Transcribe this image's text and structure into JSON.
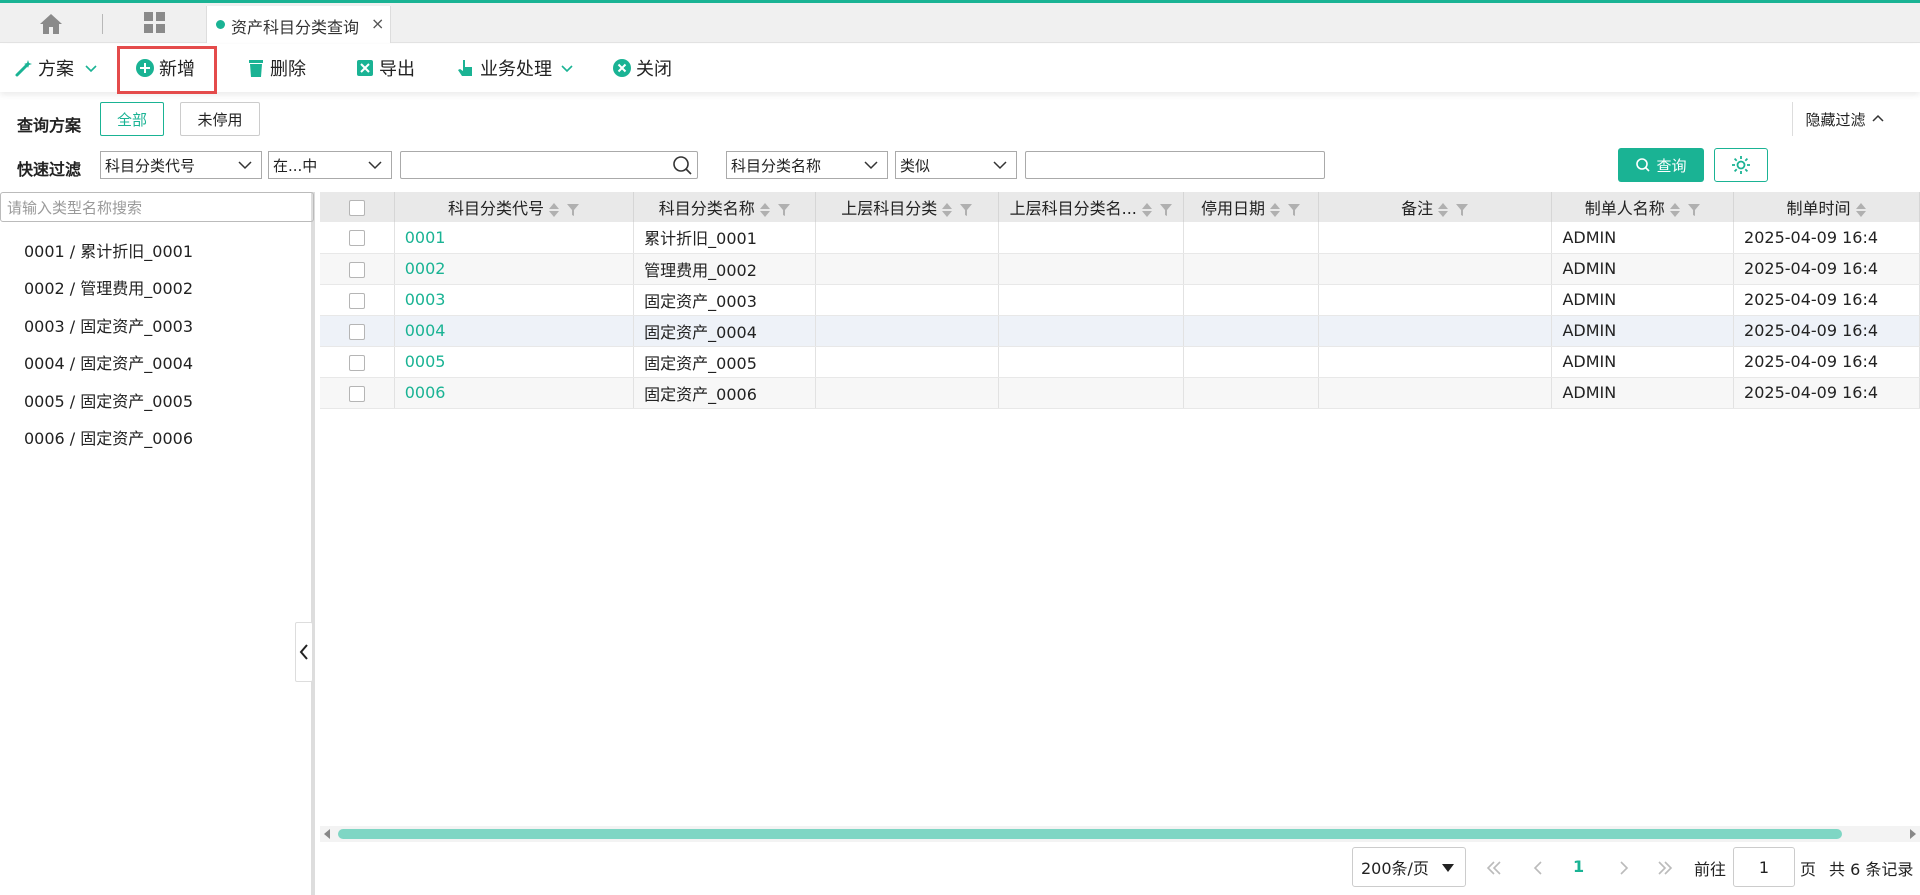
{
  "tabbar": {
    "active_tab": "资产科目分类查询",
    "close": "×"
  },
  "toolbar": {
    "plan": "方案",
    "add": "新增",
    "delete": "删除",
    "export": "导出",
    "business": "业务处理",
    "close": "关闭"
  },
  "query": {
    "plan_label": "查询方案",
    "all": "全部",
    "not_disabled": "未停用",
    "hide_filter": "隐藏过滤",
    "quick_filter_label": "快速过滤",
    "field1": "科目分类代号",
    "op1": "在...中",
    "field2": "科目分类名称",
    "op2": "类似",
    "search_button": "查询"
  },
  "left_panel": {
    "search_placeholder": "请输入类型名称搜索",
    "items": [
      "0001 / 累计折旧_0001",
      "0002 / 管理费用_0002",
      "0003 / 固定资产_0003",
      "0004 / 固定资产_0004",
      "0005 / 固定资产_0005",
      "0006 / 固定资产_0006"
    ]
  },
  "table": {
    "columns": [
      "科目分类代号",
      "科目分类名称",
      "上层科目分类",
      "上层科目分类名...",
      "停用日期",
      "备注",
      "制单人名称",
      "制单时间"
    ],
    "rows": [
      [
        "0001",
        "累计折旧_0001",
        "",
        "",
        "",
        "",
        "ADMIN",
        "2025-04-09 16:4"
      ],
      [
        "0002",
        "管理费用_0002",
        "",
        "",
        "",
        "",
        "ADMIN",
        "2025-04-09 16:4"
      ],
      [
        "0003",
        "固定资产_0003",
        "",
        "",
        "",
        "",
        "ADMIN",
        "2025-04-09 16:4"
      ],
      [
        "0004",
        "固定资产_0004",
        "",
        "",
        "",
        "",
        "ADMIN",
        "2025-04-09 16:4"
      ],
      [
        "0005",
        "固定资产_0005",
        "",
        "",
        "",
        "",
        "ADMIN",
        "2025-04-09 16:4"
      ],
      [
        "0006",
        "固定资产_0006",
        "",
        "",
        "",
        "",
        "ADMIN",
        "2025-04-09 16:4"
      ]
    ]
  },
  "pager": {
    "page_size": "200条/页",
    "current": "1",
    "goto_label": "前往",
    "goto_value": "1",
    "page_unit": "页",
    "total": "共 6 条记录"
  },
  "colors": {
    "accent": "#1ab394",
    "highlight_border": "#e44b4b"
  }
}
